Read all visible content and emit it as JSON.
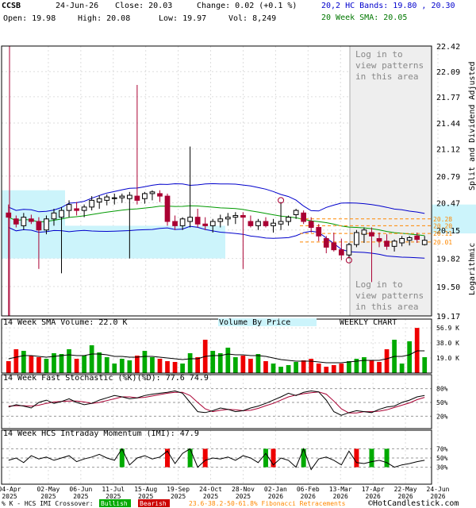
{
  "header": {
    "symbol": "CCSB",
    "date": "24-Jun-26",
    "close": "Close: 20.03",
    "change": "Change: 0.02 (+0.1 %)",
    "open": "Open: 19.98",
    "high": "High: 20.08",
    "low": "Low: 19.97",
    "vol": "Vol: 8,249",
    "bands": "20,2 HC Bands: 19.80 , 20.30",
    "sma": "20 Week SMA: 20.05"
  },
  "main_panel": {
    "login_text": [
      "Log in to",
      "view patterns",
      "in this area"
    ],
    "side_label_top": "Split and Dividend Adjusted",
    "side_label_bottom": "Logarithmic"
  },
  "volume_panel": {
    "title": "14 Week SMA Volume: 22.0 K",
    "vbp_label": "Volume By Price",
    "weekly_label": "WEEKLY CHART",
    "ticks": [
      "56.9 K",
      "38.0 K",
      "19.0 K"
    ]
  },
  "stoch_panel": {
    "title": "14 Week Fast Stochastic (%K)(%D): 77.6 74.9",
    "ticks": [
      "80%",
      "50%",
      "20%"
    ]
  },
  "imi_panel": {
    "title": "14 Week HCS Intraday Momentum (IMI): 47.9",
    "ticks": [
      "70%",
      "50%",
      "30%"
    ]
  },
  "footer": {
    "k_cross": "% K - HCS IMI Crossover:",
    "bullish": "Bullish",
    "bearish": "Bearish",
    "fib": "23.6-38.2-50-61.8% Fibonacci Retracements",
    "copyright": "©HotCandlestick.com"
  },
  "colors": {
    "up": "#00aa00",
    "down": "#aa0033",
    "band": "#0000cc",
    "sma": "#009900",
    "fib": "#ff8800",
    "vbp": "#ccf4fb",
    "shade": "#eeeeee"
  },
  "chart_data": {
    "type": "candlestick",
    "x_ticks": [
      "04-Apr 2025",
      "02-May 2025",
      "06-Jun 2025",
      "11-Jul 2025",
      "15-Aug 2025",
      "19-Sep 2025",
      "24-Oct 2025",
      "28-Nov 2025",
      "02-Jan 2026",
      "06-Feb 2026",
      "13-Mar 2026",
      "17-Apr 2026",
      "22-May 2026",
      "24-Jun 2026"
    ],
    "y_ticks": [
      22.42,
      22.09,
      21.77,
      21.44,
      21.12,
      20.79,
      20.47,
      20.15,
      19.82,
      19.5,
      19.17
    ],
    "ylim": [
      19.17,
      22.42
    ],
    "scale": "log",
    "fib_levels": [
      20.28,
      20.2,
      20.11,
      20.01
    ],
    "candles": [
      [
        20.35,
        20.45,
        19.17,
        20.3
      ],
      [
        20.28,
        20.32,
        20.18,
        20.22
      ],
      [
        20.2,
        20.35,
        20.15,
        20.3
      ],
      [
        20.28,
        20.33,
        20.22,
        20.25
      ],
      [
        20.25,
        20.3,
        19.7,
        20.15
      ],
      [
        20.15,
        20.32,
        20.1,
        20.28
      ],
      [
        20.28,
        20.4,
        20.2,
        20.35
      ],
      [
        20.3,
        20.42,
        19.65,
        20.38
      ],
      [
        20.38,
        20.5,
        20.3,
        20.45
      ],
      [
        20.4,
        20.48,
        20.32,
        20.38
      ],
      [
        20.38,
        20.45,
        20.3,
        20.42
      ],
      [
        20.42,
        20.55,
        20.38,
        20.5
      ],
      [
        20.48,
        20.56,
        20.4,
        20.52
      ],
      [
        20.5,
        20.57,
        20.44,
        20.54
      ],
      [
        20.52,
        20.58,
        20.45,
        20.53
      ],
      [
        20.53,
        20.58,
        20.47,
        20.55
      ],
      [
        20.52,
        20.6,
        19.82,
        20.56
      ],
      [
        20.55,
        21.92,
        20.45,
        20.5
      ],
      [
        20.52,
        20.6,
        20.46,
        20.58
      ],
      [
        20.58,
        20.62,
        20.5,
        20.6
      ],
      [
        20.58,
        20.62,
        20.48,
        20.55
      ],
      [
        20.55,
        20.58,
        20.2,
        20.25
      ],
      [
        20.25,
        20.32,
        20.15,
        20.2
      ],
      [
        20.2,
        20.3,
        20.15,
        20.28
      ],
      [
        20.25,
        21.15,
        20.18,
        20.3
      ],
      [
        20.3,
        20.4,
        20.18,
        20.22
      ],
      [
        20.22,
        20.3,
        20.15,
        20.2
      ],
      [
        20.2,
        20.28,
        20.12,
        20.25
      ],
      [
        20.25,
        20.33,
        20.18,
        20.28
      ],
      [
        20.28,
        20.35,
        20.2,
        20.3
      ],
      [
        20.3,
        20.36,
        20.22,
        20.32
      ],
      [
        20.32,
        20.36,
        19.7,
        20.3
      ],
      [
        20.25,
        20.32,
        20.18,
        20.2
      ],
      [
        20.2,
        20.28,
        20.15,
        20.25
      ],
      [
        20.25,
        20.3,
        20.18,
        20.2
      ],
      [
        20.2,
        20.28,
        20.12,
        20.23
      ],
      [
        20.22,
        20.48,
        20.15,
        20.25
      ],
      [
        20.25,
        20.32,
        20.2,
        20.3
      ],
      [
        20.33,
        20.4,
        20.28,
        20.38
      ],
      [
        20.35,
        20.38,
        20.22,
        20.25
      ],
      [
        20.25,
        20.3,
        20.12,
        20.18
      ],
      [
        20.18,
        20.22,
        20.02,
        20.08
      ],
      [
        20.05,
        20.08,
        19.88,
        19.95
      ],
      [
        20.0,
        20.12,
        19.9,
        19.92
      ],
      [
        19.92,
        20.05,
        19.8,
        19.86
      ],
      [
        19.86,
        20.0,
        19.82,
        19.98
      ],
      [
        19.98,
        20.15,
        19.95,
        20.12
      ],
      [
        20.1,
        20.18,
        20.0,
        20.15
      ],
      [
        20.12,
        20.18,
        19.55,
        20.08
      ],
      [
        20.05,
        20.12,
        19.95,
        20.02
      ],
      [
        20.02,
        20.1,
        19.92,
        19.96
      ],
      [
        19.96,
        20.04,
        19.9,
        20.02
      ],
      [
        20.0,
        20.08,
        19.96,
        20.05
      ],
      [
        20.03,
        20.08,
        19.97,
        20.06
      ],
      [
        20.08,
        20.12,
        20.0,
        20.04
      ],
      [
        19.98,
        20.08,
        19.97,
        20.03
      ]
    ],
    "volume_k": [
      15,
      30,
      28,
      22,
      20,
      18,
      25,
      24,
      30,
      18,
      22,
      35,
      26,
      20,
      12,
      18,
      16,
      22,
      28,
      20,
      18,
      15,
      14,
      12,
      25,
      20,
      42,
      28,
      25,
      32,
      20,
      22,
      18,
      24,
      15,
      12,
      8,
      10,
      14,
      16,
      18,
      12,
      8,
      10,
      12,
      15,
      18,
      20,
      16,
      14,
      30,
      42,
      12,
      40,
      56.9,
      20,
      28,
      10
    ],
    "volume_sma_k": [
      18,
      20,
      22,
      22,
      21,
      20,
      21,
      22,
      23,
      22,
      22,
      24,
      24,
      23,
      21,
      21,
      20,
      20,
      21,
      21,
      20,
      19,
      18,
      17,
      18,
      18,
      21,
      22,
      22,
      24,
      23,
      23,
      22,
      22,
      21,
      19,
      17,
      16,
      15,
      15,
      15,
      14,
      13,
      13,
      13,
      14,
      15,
      16,
      16,
      16,
      18,
      21,
      21,
      23,
      28,
      28,
      29,
      28
    ],
    "stoch_k": [
      40,
      45,
      42,
      38,
      50,
      55,
      48,
      52,
      58,
      50,
      45,
      48,
      55,
      60,
      65,
      62,
      58,
      60,
      65,
      68,
      70,
      72,
      75,
      70,
      50,
      30,
      28,
      32,
      38,
      35,
      30,
      32,
      38,
      42,
      48,
      55,
      62,
      70,
      65,
      72,
      75,
      73,
      55,
      30,
      22,
      28,
      32,
      30,
      28,
      35,
      40,
      42,
      50,
      55,
      62,
      65,
      70,
      74,
      78
    ],
    "stoch_d": [
      42,
      43,
      43,
      42,
      44,
      48,
      51,
      52,
      53,
      53,
      51,
      48,
      50,
      54,
      58,
      62,
      62,
      60,
      61,
      64,
      67,
      70,
      72,
      72,
      65,
      50,
      36,
      30,
      33,
      35,
      34,
      32,
      33,
      37,
      43,
      48,
      55,
      62,
      66,
      69,
      71,
      73,
      68,
      53,
      36,
      27,
      27,
      30,
      30,
      31,
      34,
      39,
      44,
      49,
      56,
      61,
      66,
      70,
      75
    ],
    "imi": [
      45,
      50,
      40,
      55,
      48,
      52,
      45,
      50,
      55,
      42,
      48,
      52,
      58,
      50,
      45,
      70,
      35,
      50,
      55,
      48,
      52,
      65,
      38,
      60,
      70,
      30,
      45,
      50,
      48,
      52,
      45,
      55,
      50,
      40,
      60,
      35,
      50,
      45,
      30,
      70,
      25,
      48,
      52,
      45,
      35,
      65,
      40,
      38,
      42,
      45,
      40,
      30,
      35,
      38,
      42,
      45,
      48
    ],
    "crossovers": [
      {
        "i": 15,
        "kind": "bull"
      },
      {
        "i": 21,
        "kind": "bear"
      },
      {
        "i": 24,
        "kind": "bull"
      },
      {
        "i": 26,
        "kind": "bear"
      },
      {
        "i": 34,
        "kind": "bull"
      },
      {
        "i": 35,
        "kind": "bear"
      },
      {
        "i": 39,
        "kind": "bull"
      },
      {
        "i": 46,
        "kind": "bear"
      },
      {
        "i": 48,
        "kind": "bull"
      },
      {
        "i": 50,
        "kind": "bull"
      }
    ]
  }
}
